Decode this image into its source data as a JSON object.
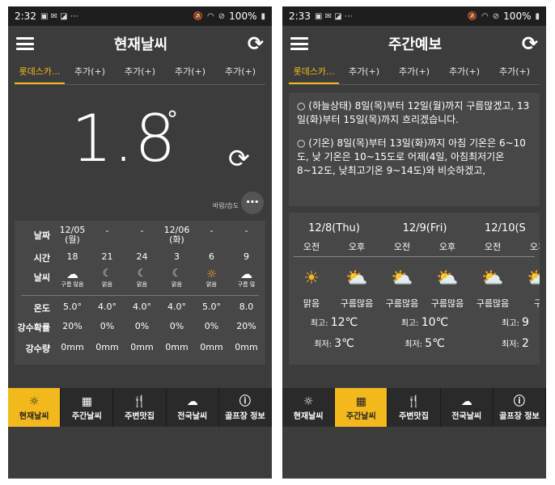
{
  "screen1": {
    "status": {
      "time": "2:32",
      "battery": "100%"
    },
    "title": "현재날씨",
    "tabs": [
      "롯데스카...",
      "추가(+)",
      "추가(+)",
      "추가(+)",
      "추가(+)"
    ],
    "current": {
      "temperature": "1.8",
      "degree_symbol": "°",
      "wind_humidity_label": "바람/습도"
    },
    "hourly": {
      "row_labels": {
        "date": "날짜",
        "time": "시간",
        "weather": "날씨",
        "temp": "온도",
        "precip_prob": "강수확률",
        "precip_amount": "강수량"
      },
      "columns": [
        {
          "date": "12/05\n(월)",
          "time": "18",
          "icon": "cloud-icon",
          "cond": "구름 많음",
          "temp": "5.0°",
          "prob": "20%",
          "amount": "0mm"
        },
        {
          "date": "-",
          "time": "21",
          "icon": "moon-icon",
          "cond": "맑음",
          "temp": "4.0°",
          "prob": "0%",
          "amount": "0mm"
        },
        {
          "date": "-",
          "time": "24",
          "icon": "moon-icon",
          "cond": "맑음",
          "temp": "4.0°",
          "prob": "0%",
          "amount": "0mm"
        },
        {
          "date": "12/06\n(화)",
          "time": "3",
          "icon": "moon-icon",
          "cond": "맑음",
          "temp": "4.0°",
          "prob": "0%",
          "amount": "0mm"
        },
        {
          "date": "-",
          "time": "6",
          "icon": "sun-icon",
          "cond": "맑음",
          "temp": "5.0°",
          "prob": "0%",
          "amount": "0mm"
        },
        {
          "date": "-",
          "time": "9",
          "icon": "cloud-icon",
          "cond": "구름 많",
          "temp": "8.0",
          "prob": "20%",
          "amount": "0mm"
        }
      ]
    },
    "nav": [
      "현재날씨",
      "주간날씨",
      "주변맛집",
      "전국날씨",
      "골프장 정보"
    ],
    "active_nav": 0
  },
  "screen2": {
    "status": {
      "time": "2:33",
      "battery": "100%"
    },
    "title": "주간예보",
    "tabs": [
      "롯데스카...",
      "추가(+)",
      "추가(+)",
      "추가(+)",
      "추가(+)"
    ],
    "forecast_text": [
      "○ (하늘상태) 8일(목)부터 12일(월)까지 구름많겠고, 13일(화)부터 15일(목)까지 흐리겠습니다.",
      "○ (기온) 8일(목)부터 13일(화)까지 아침 기온은 6~10도, 낮 기온은 10~15도로 어제(4일, 아침최저기온 8~12도, 낮최고기온 9~14도)와 비슷하겠고,"
    ],
    "daily": {
      "days": [
        "12/8(Thu)",
        "12/9(Fri)",
        "12/10(S"
      ],
      "periods": [
        "오전",
        "오후",
        "오전",
        "오후",
        "오전",
        "오후"
      ],
      "conditions": [
        {
          "icon": "sun-icon",
          "label": "맑음"
        },
        {
          "icon": "cloud-sun-icon",
          "label": "구름많음"
        },
        {
          "icon": "cloud-sun-icon",
          "label": "구름많음"
        },
        {
          "icon": "cloud-sun-icon",
          "label": "구름많음"
        },
        {
          "icon": "cloud-sun-icon",
          "label": "구름많음"
        },
        {
          "icon": "cloud-sun-icon",
          "label": "구"
        }
      ],
      "max_label": "최고:",
      "min_label": "최저:",
      "max": [
        "12℃",
        "10℃",
        "9"
      ],
      "min": [
        "3℃",
        "5℃",
        "2"
      ]
    },
    "nav": [
      "현재날씨",
      "주간날씨",
      "주변맛집",
      "전국날씨",
      "골프장 정보"
    ],
    "active_nav": 1
  },
  "colors": {
    "accent": "#f3b81c",
    "background": "#3c3c3c",
    "panel": "#474747"
  }
}
